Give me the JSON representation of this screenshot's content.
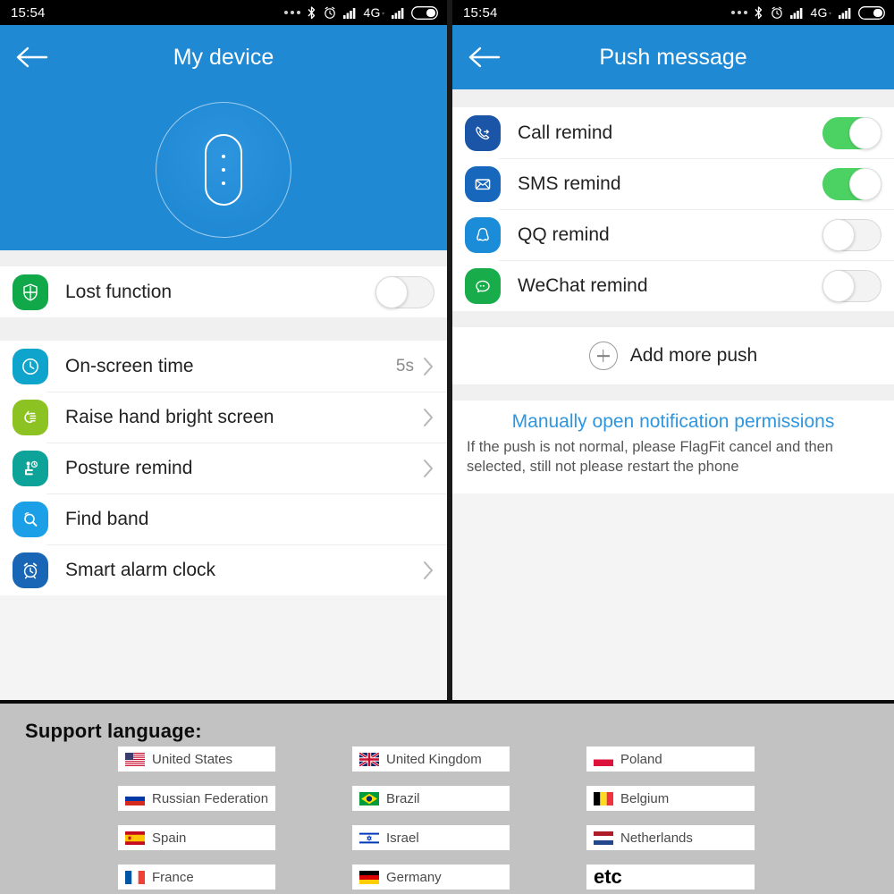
{
  "status_bar": {
    "time": "15:54",
    "network": "4G",
    "network_sub": "⁺",
    "icons": [
      "more-dots-icon",
      "bluetooth-icon",
      "alarm-icon",
      "signal-icon",
      "signal-icon",
      "battery-icon"
    ]
  },
  "colors": {
    "app_bar_blue": "#2089d4",
    "toggle_on_green": "#4cd263",
    "link_blue": "#2f96de",
    "language_bg": "#c2c2c2"
  },
  "left_panel": {
    "title": "My device",
    "back_label": "Back",
    "device_art": "fitness-band-illustration",
    "sections": [
      {
        "rows": [
          {
            "label": "Lost function",
            "icon": "shield-icon",
            "icon_color": "#11a84a",
            "control": "toggle",
            "toggle_on": false
          }
        ]
      },
      {
        "rows": [
          {
            "label": "On-screen time",
            "icon": "clock-icon",
            "icon_color": "#0fa4cb",
            "control": "value-chevron",
            "value": "5s"
          },
          {
            "label": "Raise hand bright screen",
            "icon": "raise-hand-icon",
            "icon_color": "#8cc322",
            "control": "chevron"
          },
          {
            "label": "Posture remind",
            "icon": "posture-icon",
            "icon_color": "#0da398",
            "control": "chevron"
          },
          {
            "label": "Find band",
            "icon": "find-band-icon",
            "icon_color": "#1ba0e8",
            "control": "none"
          },
          {
            "label": "Smart alarm clock",
            "icon": "alarm-clock-icon",
            "icon_color": "#1866b5",
            "control": "chevron"
          }
        ]
      }
    ]
  },
  "right_panel": {
    "title": "Push message",
    "back_label": "Back",
    "rows": [
      {
        "label": "Call remind",
        "icon": "phone-icon",
        "icon_color": "#1b55a8",
        "toggle_on": true
      },
      {
        "label": "SMS remind",
        "icon": "envelope-icon",
        "icon_color": "#1767bd",
        "toggle_on": true
      },
      {
        "label": "QQ remind",
        "icon": "qq-penguin-icon",
        "icon_color": "#1b8cd8",
        "toggle_on": false
      },
      {
        "label": "WeChat remind",
        "icon": "wechat-icon",
        "icon_color": "#18ad4a",
        "toggle_on": false
      }
    ],
    "add_more": {
      "label": "Add more push",
      "icon": "plus-circle-icon"
    },
    "note": {
      "link": "Manually open notification permissions",
      "description": "If the push is not normal, please FlagFit cancel and then selected, still not please restart the phone"
    }
  },
  "language_section": {
    "heading": "Support language:",
    "columns": [
      [
        {
          "name": "United States",
          "flag": "flag-us"
        },
        {
          "name": "Russian Federation",
          "flag": "flag-ru"
        },
        {
          "name": "Spain",
          "flag": "flag-es"
        },
        {
          "name": "France",
          "flag": "flag-fr"
        }
      ],
      [
        {
          "name": "United Kingdom",
          "flag": "flag-gb"
        },
        {
          "name": "Brazil",
          "flag": "flag-br"
        },
        {
          "name": "Israel",
          "flag": "flag-il"
        },
        {
          "name": "Germany",
          "flag": "flag-de"
        }
      ],
      [
        {
          "name": "Poland",
          "flag": "flag-pl"
        },
        {
          "name": "Belgium",
          "flag": "flag-be"
        },
        {
          "name": "Netherlands",
          "flag": "flag-nl"
        },
        {
          "name": "etc",
          "flag": "none"
        }
      ]
    ]
  }
}
